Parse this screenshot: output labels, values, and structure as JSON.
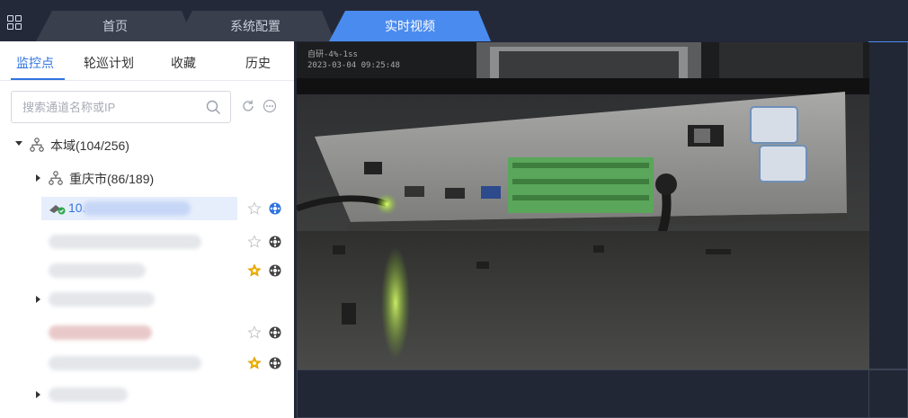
{
  "topbar": {
    "tabs": [
      {
        "label": "首页"
      },
      {
        "label": "系统配置"
      },
      {
        "label": "实时视频"
      }
    ]
  },
  "sidebar": {
    "tabs": [
      {
        "label": "监控点"
      },
      {
        "label": "轮巡计划"
      },
      {
        "label": "收藏"
      },
      {
        "label": "历史"
      }
    ],
    "search": {
      "placeholder": "搜索通道名称或IP"
    },
    "tree": {
      "root": {
        "label": "本域(104/256)"
      },
      "child": {
        "label": "重庆市(86/189)"
      },
      "selected_channel": {
        "label": "10."
      }
    }
  },
  "video": {
    "osd_line1": "自研-4%-1ss",
    "osd_line2": "2023-03-04 09:25:48"
  },
  "colors": {
    "accent": "#4a8bef",
    "favorite": "#f2b705",
    "panel_bg": "#ffffff",
    "topbar_bg": "#24293a"
  }
}
